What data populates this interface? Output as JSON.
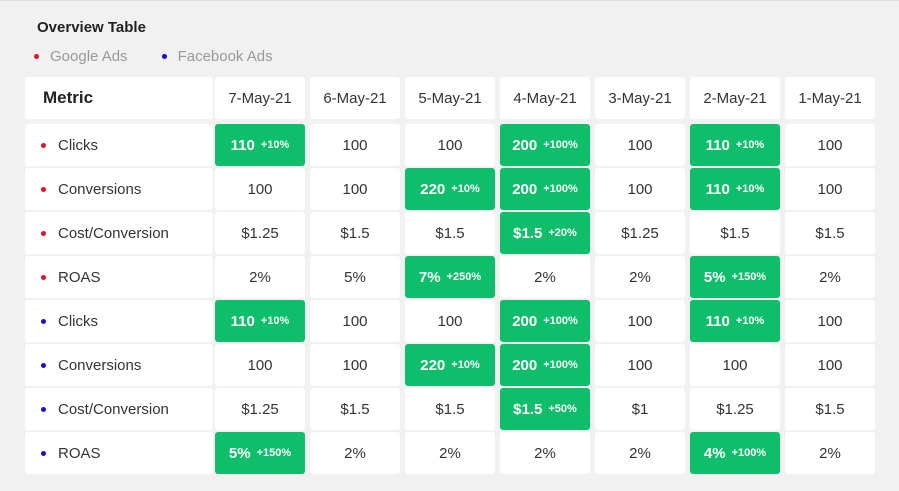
{
  "title": "Overview Table",
  "legend": [
    {
      "label": "Google Ads",
      "color": "#e8101c"
    },
    {
      "label": "Facebook Ads",
      "color": "#0f0fd9"
    }
  ],
  "header": {
    "metric": "Metric",
    "dates": [
      "7-May-21",
      "6-May-21",
      "5-May-21",
      "4-May-21",
      "3-May-21",
      "2-May-21",
      "1-May-21"
    ]
  },
  "highlight_color": "#0fbe6a",
  "rows": [
    {
      "metric": "Clicks",
      "source": 0,
      "cells": [
        {
          "v": "110",
          "c": "+10%"
        },
        {
          "v": "100"
        },
        {
          "v": "100"
        },
        {
          "v": "200",
          "c": "+100%"
        },
        {
          "v": "100"
        },
        {
          "v": "110",
          "c": "+10%"
        },
        {
          "v": "100"
        }
      ]
    },
    {
      "metric": "Conversions",
      "source": 0,
      "cells": [
        {
          "v": "100"
        },
        {
          "v": "100"
        },
        {
          "v": "220",
          "c": "+10%"
        },
        {
          "v": "200",
          "c": "+100%"
        },
        {
          "v": "100"
        },
        {
          "v": "110",
          "c": "+10%"
        },
        {
          "v": "100"
        }
      ]
    },
    {
      "metric": "Cost/Conversion",
      "source": 0,
      "cells": [
        {
          "v": "$1.25"
        },
        {
          "v": "$1.5"
        },
        {
          "v": "$1.5"
        },
        {
          "v": "$1.5",
          "c": "+20%"
        },
        {
          "v": "$1.25"
        },
        {
          "v": "$1.5"
        },
        {
          "v": "$1.5"
        }
      ]
    },
    {
      "metric": "ROAS",
      "source": 0,
      "cells": [
        {
          "v": "2%"
        },
        {
          "v": "5%"
        },
        {
          "v": "7%",
          "c": "+250%"
        },
        {
          "v": "2%"
        },
        {
          "v": "2%"
        },
        {
          "v": "5%",
          "c": "+150%"
        },
        {
          "v": "2%"
        }
      ]
    },
    {
      "metric": "Clicks",
      "source": 1,
      "cells": [
        {
          "v": "110",
          "c": "+10%"
        },
        {
          "v": "100"
        },
        {
          "v": "100"
        },
        {
          "v": "200",
          "c": "+100%"
        },
        {
          "v": "100"
        },
        {
          "v": "110",
          "c": "+10%"
        },
        {
          "v": "100"
        }
      ]
    },
    {
      "metric": "Conversions",
      "source": 1,
      "cells": [
        {
          "v": "100"
        },
        {
          "v": "100"
        },
        {
          "v": "220",
          "c": "+10%"
        },
        {
          "v": "200",
          "c": "+100%"
        },
        {
          "v": "100"
        },
        {
          "v": "100"
        },
        {
          "v": "100"
        }
      ]
    },
    {
      "metric": "Cost/Conversion",
      "source": 1,
      "cells": [
        {
          "v": "$1.25"
        },
        {
          "v": "$1.5"
        },
        {
          "v": "$1.5"
        },
        {
          "v": "$1.5",
          "c": "+50%"
        },
        {
          "v": "$1"
        },
        {
          "v": "$1.25"
        },
        {
          "v": "$1.5"
        }
      ]
    },
    {
      "metric": "ROAS",
      "source": 1,
      "cells": [
        {
          "v": "5%",
          "c": "+150%"
        },
        {
          "v": "2%"
        },
        {
          "v": "2%"
        },
        {
          "v": "2%"
        },
        {
          "v": "2%"
        },
        {
          "v": "4%",
          "c": "+100%"
        },
        {
          "v": "2%"
        }
      ]
    }
  ]
}
